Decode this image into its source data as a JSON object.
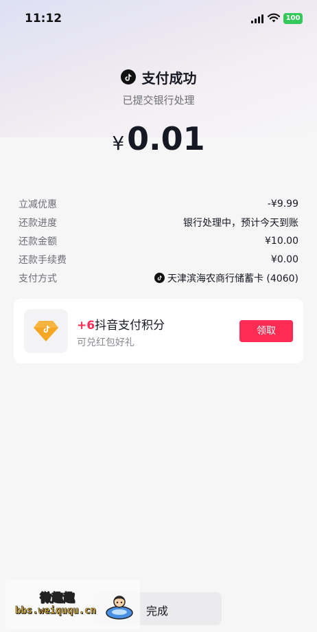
{
  "status_bar": {
    "time": "11:12",
    "battery_level": "100"
  },
  "header": {
    "title": "支付成功",
    "subtitle": "已提交银行处理"
  },
  "amount": {
    "currency": "¥",
    "value": "0.01"
  },
  "details": [
    {
      "label": "立减优惠",
      "value": "-¥9.99"
    },
    {
      "label": "还款进度",
      "value": "银行处理中，预计今天到账"
    },
    {
      "label": "还款金额",
      "value": "¥10.00"
    },
    {
      "label": "还款手续费",
      "value": "¥0.00"
    },
    {
      "label": "支付方式",
      "value": "天津滨海农商行储蓄卡 (4060)"
    }
  ],
  "reward_card": {
    "points": "+6",
    "title": "抖音支付积分",
    "description": "可兑红包好礼",
    "claim_label": "领取"
  },
  "done_label": "完成",
  "watermark": {
    "line1": "微趣趣",
    "line2": "bbs.weiququ.cn"
  },
  "colors": {
    "accent": "#fe2c55",
    "battery": "#34c759",
    "background": "#f6f6f7"
  },
  "icons": [
    "signal-icon",
    "wifi-icon",
    "battery-icon",
    "douyin-logo-icon",
    "points-diamond-icon"
  ]
}
